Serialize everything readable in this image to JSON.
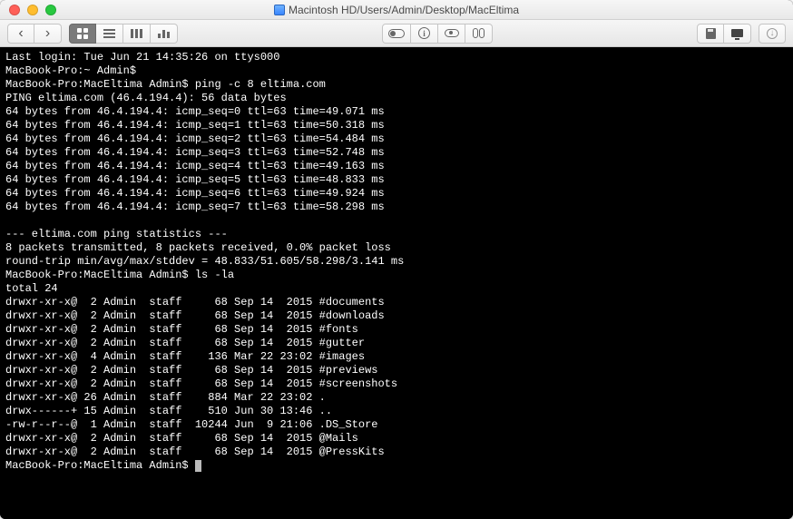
{
  "window": {
    "title": "Macintosh HD/Users/Admin/Desktop/MacEltima"
  },
  "toolbar": {
    "back": "‹",
    "forward": "›"
  },
  "session": {
    "last_login": "Last login: Tue Jun 21 14:35:26 on ttys000",
    "prompt_home": "MacBook-Pro:~ Admin$",
    "prompt_dir": "MacBook-Pro:MacEltima Admin$",
    "cmd_ping": "ping -c 8 eltima.com",
    "ping_header": "PING eltima.com (46.4.194.4): 56 data bytes",
    "ping_lines": [
      "64 bytes from 46.4.194.4: icmp_seq=0 ttl=63 time=49.071 ms",
      "64 bytes from 46.4.194.4: icmp_seq=1 ttl=63 time=50.318 ms",
      "64 bytes from 46.4.194.4: icmp_seq=2 ttl=63 time=54.484 ms",
      "64 bytes from 46.4.194.4: icmp_seq=3 ttl=63 time=52.748 ms",
      "64 bytes from 46.4.194.4: icmp_seq=4 ttl=63 time=49.163 ms",
      "64 bytes from 46.4.194.4: icmp_seq=5 ttl=63 time=48.833 ms",
      "64 bytes from 46.4.194.4: icmp_seq=6 ttl=63 time=49.924 ms",
      "64 bytes from 46.4.194.4: icmp_seq=7 ttl=63 time=58.298 ms"
    ],
    "ping_stats_hdr": "--- eltima.com ping statistics ---",
    "ping_stats_1": "8 packets transmitted, 8 packets received, 0.0% packet loss",
    "ping_stats_2": "round-trip min/avg/max/stddev = 48.833/51.605/58.298/3.141 ms",
    "cmd_ls": "ls -la",
    "ls_total": "total 24",
    "ls_rows": [
      "drwxr-xr-x@  2 Admin  staff     68 Sep 14  2015 #documents",
      "drwxr-xr-x@  2 Admin  staff     68 Sep 14  2015 #downloads",
      "drwxr-xr-x@  2 Admin  staff     68 Sep 14  2015 #fonts",
      "drwxr-xr-x@  2 Admin  staff     68 Sep 14  2015 #gutter",
      "drwxr-xr-x@  4 Admin  staff    136 Mar 22 23:02 #images",
      "drwxr-xr-x@  2 Admin  staff     68 Sep 14  2015 #previews",
      "drwxr-xr-x@  2 Admin  staff     68 Sep 14  2015 #screenshots",
      "drwxr-xr-x@ 26 Admin  staff    884 Mar 22 23:02 .",
      "drwx------+ 15 Admin  staff    510 Jun 30 13:46 ..",
      "-rw-r--r--@  1 Admin  staff  10244 Jun  9 21:06 .DS_Store",
      "drwxr-xr-x@  2 Admin  staff     68 Sep 14  2015 @Mails",
      "drwxr-xr-x@  2 Admin  staff     68 Sep 14  2015 @PressKits"
    ]
  }
}
